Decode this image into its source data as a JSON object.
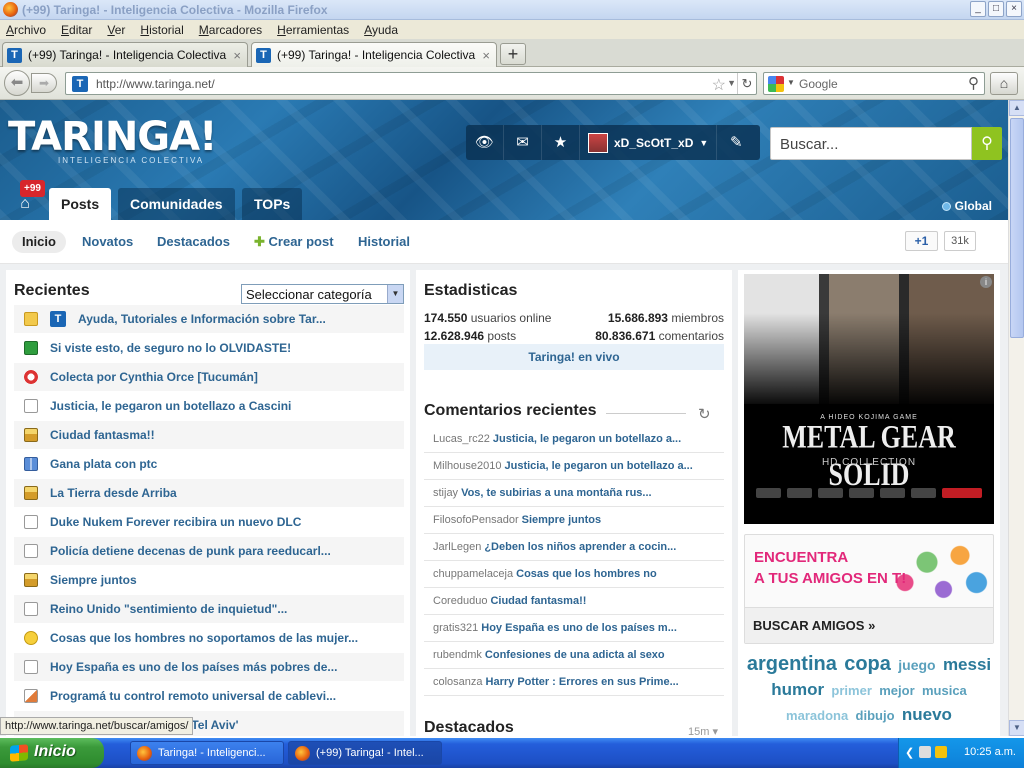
{
  "browser": {
    "window_title": "(+99) Taringa! - Inteligencia Colectiva - Mozilla Firefox",
    "menu": [
      "Archivo",
      "Editar",
      "Ver",
      "Historial",
      "Marcadores",
      "Herramientas",
      "Ayuda"
    ],
    "tabs": [
      {
        "label": "(+99) Taringa! - Inteligencia Colectiva",
        "active": false
      },
      {
        "label": "(+99) Taringa! - Inteligencia Colectiva",
        "active": true
      }
    ],
    "url": "http://www.taringa.net/",
    "search_placeholder": "Google",
    "status_url": "http://www.taringa.net/buscar/amigos/"
  },
  "site": {
    "logo": "TARINGA!",
    "logo_sub": "INTELIGENCIA COLECTIVA",
    "username": "xD_ScOtT_xD",
    "search_placeholder": "Buscar...",
    "notification_badge": "+99",
    "nav_tabs": [
      "Posts",
      "Comunidades",
      "TOPs"
    ],
    "region": "Global",
    "subnav": [
      "Inicio",
      "Novatos",
      "Destacados",
      "Crear post",
      "Historial"
    ],
    "gplus_label": "+1",
    "gplus_count": "31k"
  },
  "recientes": {
    "title": "Recientes",
    "category_select": "Seleccionar categoría",
    "posts": [
      {
        "title": "Ayuda, Tutoriales e Información sobre Tar...",
        "icon": "folder-icon"
      },
      {
        "title": "Si viste esto, de seguro no lo OLVIDASTE!",
        "icon": "film-icon"
      },
      {
        "title": "Colecta por Cynthia Orce [Tucumán]",
        "icon": "lifebuoy-icon"
      },
      {
        "title": "Justicia, le pegaron un botellazo a Cascini",
        "icon": "document-icon"
      },
      {
        "title": "Ciudad fantasma!!",
        "icon": "image-icon"
      },
      {
        "title": "Gana plata con ptc",
        "icon": "book-icon"
      },
      {
        "title": "La Tierra desde Arriba",
        "icon": "image-icon"
      },
      {
        "title": "Duke Nukem Forever recibira un nuevo DLC",
        "icon": "document-icon"
      },
      {
        "title": "Policía detiene decenas de punk para reeducarl...",
        "icon": "document-icon"
      },
      {
        "title": "Siempre juntos",
        "icon": "image-icon"
      },
      {
        "title": "Reino Unido \"sentimiento de inquietud\"...",
        "icon": "document-icon"
      },
      {
        "title": "Cosas que los hombres no soportamos de las mujer...",
        "icon": "smiley-icon"
      },
      {
        "title": "Hoy España es uno de los países más pobres de...",
        "icon": "document-icon"
      },
      {
        "title": "Programá tu control remoto universal de cablevi...",
        "icon": "chart-icon"
      },
      {
        "title": "Lo que no te cuentan de Tel Aviv'",
        "icon": "document-icon"
      }
    ]
  },
  "estadisticas": {
    "title": "Estadisticas",
    "users_online": "174.550",
    "users_online_label": "usuarios online",
    "members": "15.686.893",
    "members_label": "miembros",
    "posts": "12.628.946",
    "posts_label": "posts",
    "comments": "80.836.671",
    "comments_label": "comentarios",
    "live_label": "Taringa! en vivo"
  },
  "comentarios": {
    "title": "Comentarios recientes",
    "items": [
      {
        "user": "Lucas_rc22",
        "text": "Justicia, le pegaron un botellazo a..."
      },
      {
        "user": "Milhouse2010",
        "text": "Justicia, le pegaron un botellazo a..."
      },
      {
        "user": "stijay",
        "text": "Vos, te subirias a una montaña rus..."
      },
      {
        "user": "FilosofoPensador",
        "text": "Siempre juntos"
      },
      {
        "user": "JarlLegen",
        "text": "¿Deben los niños aprender a cocin..."
      },
      {
        "user": "chuppamelaceja",
        "text": "Cosas que los hombres no"
      },
      {
        "user": "Coreduduo",
        "text": "Ciudad fantasma!!"
      },
      {
        "user": "gratis321",
        "text": "Hoy España es uno de los países m..."
      },
      {
        "user": "rubendmk",
        "text": "Confesiones de una adicta al sexo"
      },
      {
        "user": "colosanza",
        "text": "Harry Potter : Errores en sus Prime..."
      }
    ]
  },
  "destacados": {
    "title": "Destacados",
    "time": "15m"
  },
  "ad": {
    "tagline": "A HIDEO KOJIMA GAME",
    "title": "METAL GEAR SOLID",
    "subtitle": "HD COLLECTION"
  },
  "friends": {
    "line1": "ENCUENTRA",
    "line2": "A TUS AMIGOS EN T!",
    "button": "BUSCAR AMIGOS »"
  },
  "tags": [
    {
      "text": "argentina",
      "color": "#2b7a9a",
      "size": 20
    },
    {
      "text": "copa",
      "color": "#2b7a9a",
      "size": 20
    },
    {
      "text": "juego",
      "color": "#5aa0bc",
      "size": 14
    },
    {
      "text": "messi",
      "color": "#2b7a9a",
      "size": 17
    },
    {
      "text": "humor",
      "color": "#2b7a9a",
      "size": 17
    },
    {
      "text": "primer",
      "color": "#8cc4da",
      "size": 13
    },
    {
      "text": "mejor",
      "color": "#5aa0bc",
      "size": 13
    },
    {
      "text": "musica",
      "color": "#5aa0bc",
      "size": 13
    },
    {
      "text": "maradona",
      "color": "#8cc4da",
      "size": 13
    },
    {
      "text": "dibujo",
      "color": "#5aa0bc",
      "size": 13
    },
    {
      "text": "nuevo",
      "color": "#2b7a9a",
      "size": 17
    }
  ],
  "taskbar": {
    "start": "Inicio",
    "items": [
      "Taringa! - Inteligenci...",
      "(+99) Taringa! - Intel..."
    ],
    "clock": "10:25 a.m."
  }
}
